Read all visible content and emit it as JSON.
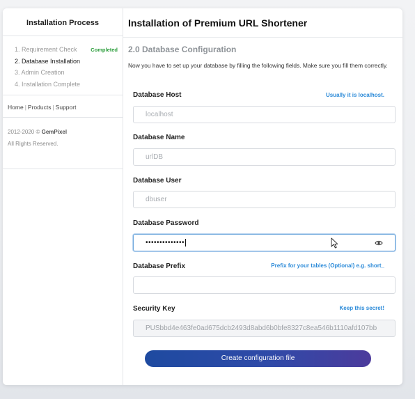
{
  "sidebar": {
    "title": "Installation Process",
    "steps": [
      {
        "label": "1. Requirement Check",
        "badge": "Completed"
      },
      {
        "label": "2. Database Installation"
      },
      {
        "label": "3. Admin Creation"
      },
      {
        "label": "4. Installation Complete"
      }
    ],
    "links": [
      "Home",
      "Products",
      "Support"
    ],
    "copyright_years": "2012-2020 ©",
    "copyright_brand": "GemPixel",
    "rights": "All Rights Reserved."
  },
  "main": {
    "title": "Installation of Premium URL Shortener",
    "section_title": "2.0 Database Configuration",
    "intro": "Now you have to set up your database by filling the following fields. Make sure you fill them correctly.",
    "fields": {
      "host": {
        "label": "Database Host",
        "hint": "Usually it is localhost.",
        "value": "localhost"
      },
      "name": {
        "label": "Database Name",
        "value": "urlDB"
      },
      "user": {
        "label": "Database User",
        "value": "dbuser"
      },
      "password": {
        "label": "Database Password",
        "value": "••••••••••••••"
      },
      "prefix": {
        "label": "Database Prefix",
        "hint": "Prefix for your tables (Optional) e.g. short_",
        "value": ""
      },
      "key": {
        "label": "Security Key",
        "hint": "Keep this secret!",
        "value": "PUSbbd4e463fe0ad675dcb2493d8abd6b0bfe8327c8ea546b1110afd107bb"
      }
    },
    "submit_label": "Create configuration file"
  },
  "colors": {
    "accent": "#2b8ad8",
    "completed": "#2a9d3a",
    "button_start": "#1e4aa0",
    "button_end": "#4c3b9c"
  }
}
